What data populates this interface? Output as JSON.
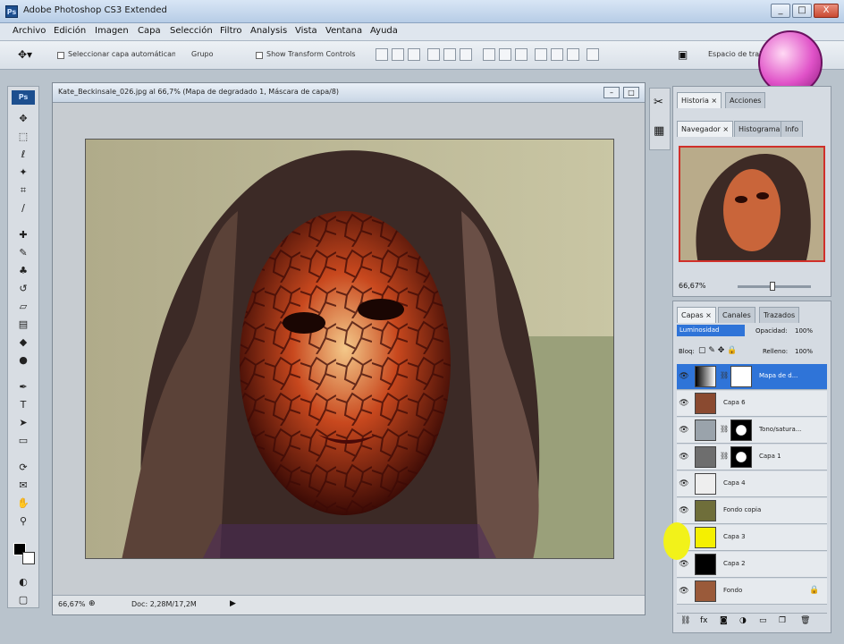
{
  "window": {
    "title": "Adobe Photoshop CS3 Extended",
    "app_badge": "Ps",
    "buttons": {
      "minimize": "_",
      "maximize": "□",
      "close": "X"
    }
  },
  "menu": [
    "Archivo",
    "Edición",
    "Imagen",
    "Capa",
    "Selección",
    "Filtro",
    "Analysis",
    "Vista",
    "Ventana",
    "Ayuda"
  ],
  "options_bar": {
    "autoselect_label": "Seleccionar capa automáticamente",
    "autoselect_value": "Grupo",
    "transform_label": "Show Transform Controls",
    "workspace_label": "Espacio de trabajo"
  },
  "document": {
    "title": "Kate_Beckinsale_026.jpg al 66,7% (Mapa de degradado 1, Máscara de capa/8)",
    "zoom": "66,67%",
    "doc_info": "Doc: 2,28M/17,2M"
  },
  "navigator": {
    "top_tabs": [
      "Historia ×",
      "Acciones"
    ],
    "tabs": [
      "Navegador ×",
      "Histograma",
      "Info"
    ],
    "zoom": "66,67%"
  },
  "layers_panel": {
    "tabs": [
      "Capas ×",
      "Canales",
      "Trazados"
    ],
    "blend_mode": "Luminosidad",
    "opacity_label": "Opacidad:",
    "opacity_value": "100%",
    "lock_label": "Bloq:",
    "fill_label": "Relleno:",
    "fill_value": "100%",
    "layers": [
      {
        "name": "Mapa de d...",
        "selected": true
      },
      {
        "name": "Capa 6",
        "selected": false
      },
      {
        "name": "Tono/satura...",
        "selected": false
      },
      {
        "name": "Capa 1",
        "selected": false
      },
      {
        "name": "Capa 4",
        "selected": false
      },
      {
        "name": "Fondo copia",
        "selected": false
      },
      {
        "name": "Capa 3",
        "selected": false
      },
      {
        "name": "Capa 2",
        "selected": false
      },
      {
        "name": "Fondo",
        "selected": false
      }
    ]
  }
}
